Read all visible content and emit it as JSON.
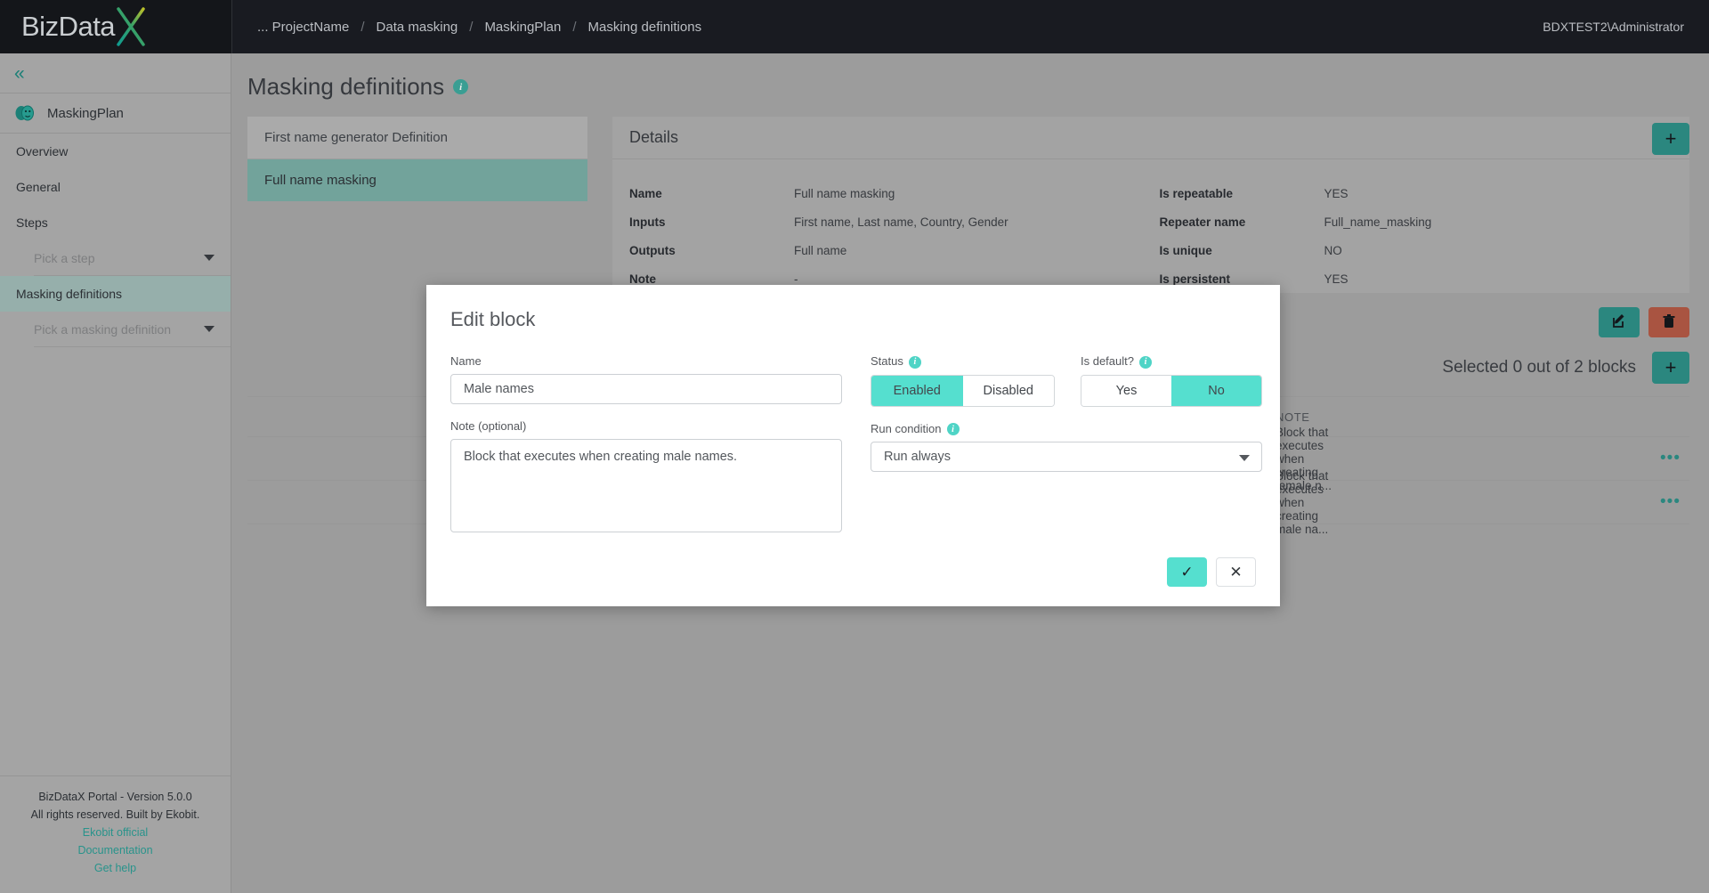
{
  "brand": {
    "name_left": "BizData",
    "name_x": "X"
  },
  "topbar": {
    "breadcrumbs": [
      {
        "label": "... ProjectName"
      },
      {
        "label": "/"
      },
      {
        "label": "Data masking"
      },
      {
        "label": "/"
      },
      {
        "label": "MaskingPlan"
      },
      {
        "label": "/"
      },
      {
        "label": "Masking definitions"
      }
    ],
    "user": "BDXTEST2\\Administrator"
  },
  "sidebar": {
    "collapse_icon": "chevron-double-left-icon",
    "plan_name": "MaskingPlan",
    "items": [
      {
        "label": "Overview",
        "active": false
      },
      {
        "label": "General",
        "active": false
      },
      {
        "label": "Steps",
        "active": false
      }
    ],
    "step_picker_placeholder": "Pick a step",
    "masking_definitions_label": "Masking definitions",
    "masking_picker_placeholder": "Pick a masking definition",
    "footer": {
      "version": "BizDataX Portal - Version 5.0.0",
      "rights": "All rights reserved. Built by Ekobit.",
      "links": [
        "Ekobit official",
        "Documentation",
        "Get help"
      ]
    }
  },
  "page": {
    "title": "Masking definitions",
    "info_glyph": "i",
    "add_glyph": "+"
  },
  "definitions": [
    {
      "label": "First name generator Definition",
      "active": false
    },
    {
      "label": "Full name masking",
      "active": true
    }
  ],
  "details": {
    "heading": "Details",
    "left_rows": [
      {
        "key": "Name",
        "value": "Full name masking"
      },
      {
        "key": "Inputs",
        "value": "First name, Last name, Country, Gender"
      },
      {
        "key": "Outputs",
        "value": "Full name"
      },
      {
        "key": "Note",
        "value": "-"
      }
    ],
    "right_rows": [
      {
        "key": "Is repeatable",
        "value": "YES"
      },
      {
        "key": "Repeater name",
        "value": "Full_name_masking"
      },
      {
        "key": "Is unique",
        "value": "NO"
      },
      {
        "key": "Is persistent",
        "value": "YES"
      }
    ],
    "edit_icon": "pencil-square-icon",
    "delete_icon": "trash-icon"
  },
  "blocks": {
    "selection_text": "Selected 0 out of 2 blocks",
    "add_glyph": "+",
    "columns": [
      {
        "label": "NOTE"
      }
    ],
    "rows": [
      {
        "note": "Block that executes when creating female n...",
        "menu": "•••"
      },
      {
        "note": "Block that executes when creating male na...",
        "menu": "•••"
      }
    ]
  },
  "modal": {
    "title": "Edit block",
    "name_label": "Name",
    "name_value": "Male names",
    "note_label": "Note (optional)",
    "note_value": "Block that executes when creating male names.",
    "status_label": "Status",
    "status_options": [
      {
        "label": "Enabled",
        "selected": true
      },
      {
        "label": "Disabled",
        "selected": false
      }
    ],
    "is_default_label": "Is default?",
    "is_default_options": [
      {
        "label": "Yes",
        "selected": false
      },
      {
        "label": "No",
        "selected": true
      }
    ],
    "run_condition_label": "Run condition",
    "run_condition_value": "Run always",
    "confirm_glyph": "✓",
    "cancel_glyph": "✕"
  },
  "colors": {
    "accent_teal": "#2f9289",
    "accent_mint": "#55dfcf",
    "info_teal": "#3fab9f",
    "danger": "#b65b46",
    "topbar_dark": "#1b1e24",
    "body_gray": "#a8a8a8",
    "active_sidebar": "#a2bdb8",
    "active_def": "#7bb0a7"
  }
}
